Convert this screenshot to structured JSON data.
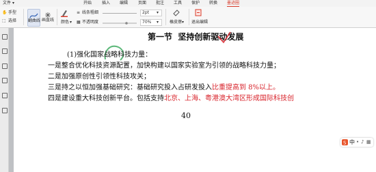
{
  "menu": {
    "file": "文件",
    "items": [
      "开始",
      "插入",
      "编辑",
      "页面",
      "批注",
      "工具",
      "保护",
      "转换",
      "墨迹圈"
    ]
  },
  "toolbar": {
    "hand": "手型",
    "select": "选择",
    "brush": "画笔",
    "brush_active": "翻曲线",
    "rect_tool": "画直线",
    "line_weight_label": "线条粗细",
    "line_weight_value": "2pt",
    "color_label": "颜色",
    "opacity_label": "不透明度",
    "opacity_value": "70%",
    "eraser": "橡皮擦",
    "exit": "退出编辑"
  },
  "document": {
    "heading_prefix": "第一节",
    "heading_main": "坚持创新驱动发展",
    "line1": "(1)强化国家战略科技力量：",
    "line2": "一是整合优化科技资源配置，加快构建以国家实验室为引领的战略科技力量；",
    "line3": "二是加强原创性引领性科技攻关；",
    "line4_normal": "三是持之以恒加强基础研究：基础研究投入占研发投入",
    "line4_red": "比重提高到 8%以上。",
    "line5_normal": "四是建设重大科技创新平台。包括支持",
    "line5_red": "北京、上海、粤港澳大湾区形成国际科技创",
    "page_number": "40"
  },
  "ime": {
    "label": "中",
    "colors": {
      "logo": "#e8542a"
    }
  },
  "colors": {
    "accent": "#d83b2a",
    "highlight_text": "#d8222a",
    "tool_selected": "#dfe6f3"
  }
}
